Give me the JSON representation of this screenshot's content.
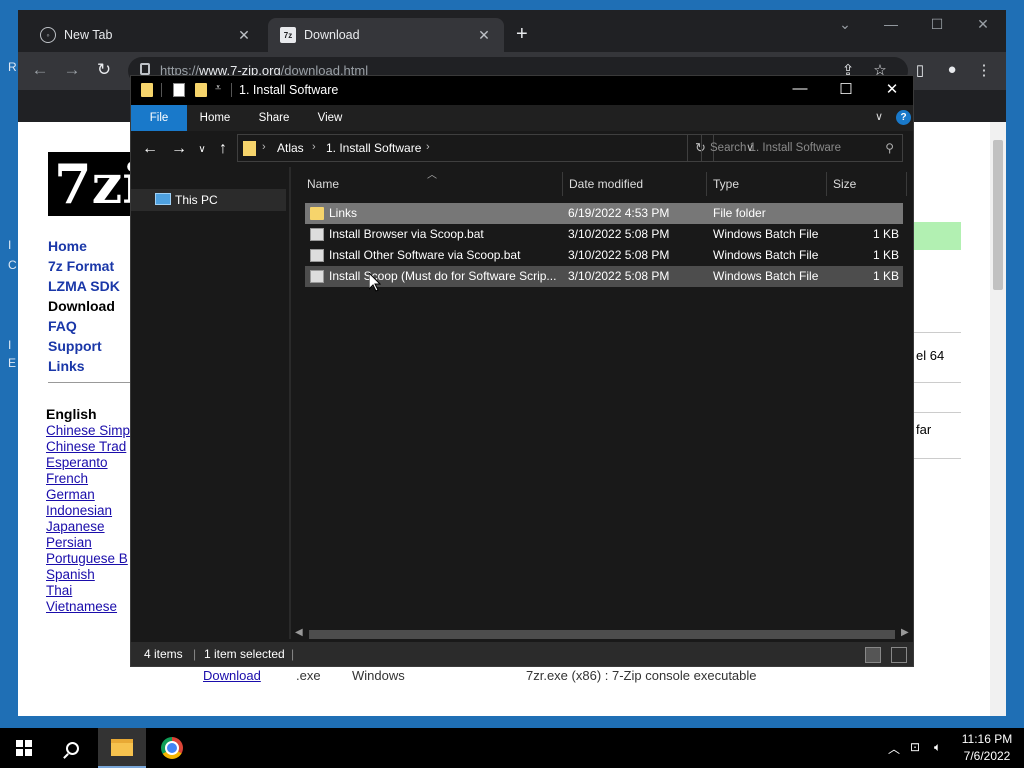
{
  "desktop": {
    "glyphs": [
      "R",
      "I",
      "C",
      "I",
      "E"
    ]
  },
  "browser": {
    "tabs": [
      {
        "title": "New Tab",
        "icon": "globe-icon"
      },
      {
        "title": "Download",
        "icon": "7z-favicon"
      }
    ],
    "favicon_7z_text": "7z",
    "url_prefix": "https://",
    "url_host": "www.7-zip.org",
    "url_path": "/download.html",
    "page": {
      "logo_text": "7zi",
      "nav": [
        "Home",
        "7z Format",
        "LZMA SDK",
        "Download",
        "FAQ",
        "Support",
        "Links"
      ],
      "language_heading": "English",
      "languages": [
        "Chinese Simp",
        "Chinese Trad",
        "Esperanto",
        "French",
        "German",
        "Indonesian",
        "Japanese",
        "Persian",
        "Portuguese B",
        "Spanish",
        "Thai",
        "Vietnamese"
      ],
      "right_fragments": [
        "el 64",
        "far"
      ],
      "bottom_row": {
        "link": "Download",
        "ext": ".exe",
        "os": "Windows",
        "desc": "7zr.exe (x86) : 7-Zip console executable"
      }
    }
  },
  "explorer": {
    "title": "1. Install Software",
    "ribbon_tabs": [
      "File",
      "Home",
      "Share",
      "View"
    ],
    "breadcrumb": [
      "Atlas",
      "1. Install Software"
    ],
    "search_placeholder": "Search 1. Install Software",
    "nav_pane": {
      "this_pc": "This PC"
    },
    "columns": {
      "name": "Name",
      "date": "Date modified",
      "type": "Type",
      "size": "Size"
    },
    "files": [
      {
        "name": "Links",
        "date": "6/19/2022 4:53 PM",
        "type": "File folder",
        "size": "",
        "kind": "folder"
      },
      {
        "name": "Install Browser via Scoop.bat",
        "date": "3/10/2022 5:08 PM",
        "type": "Windows Batch File",
        "size": "1 KB",
        "kind": "bat"
      },
      {
        "name": "Install Other Software via Scoop.bat",
        "date": "3/10/2022 5:08 PM",
        "type": "Windows Batch File",
        "size": "1 KB",
        "kind": "bat"
      },
      {
        "name": "Install Scoop (Must do for Software Scrip...",
        "date": "3/10/2022 5:08 PM",
        "type": "Windows Batch File",
        "size": "1 KB",
        "kind": "bat"
      }
    ],
    "status": {
      "count": "4 items",
      "selected": "1 item selected"
    }
  },
  "taskbar": {
    "time": "11:16 PM",
    "date": "7/6/2022"
  },
  "colors": {
    "desktop": "#1f6fb5",
    "accent_blue": "#1979ca",
    "folder_yellow": "#f6d46b",
    "link_blue": "#1a37a8",
    "selection": "#777777"
  }
}
